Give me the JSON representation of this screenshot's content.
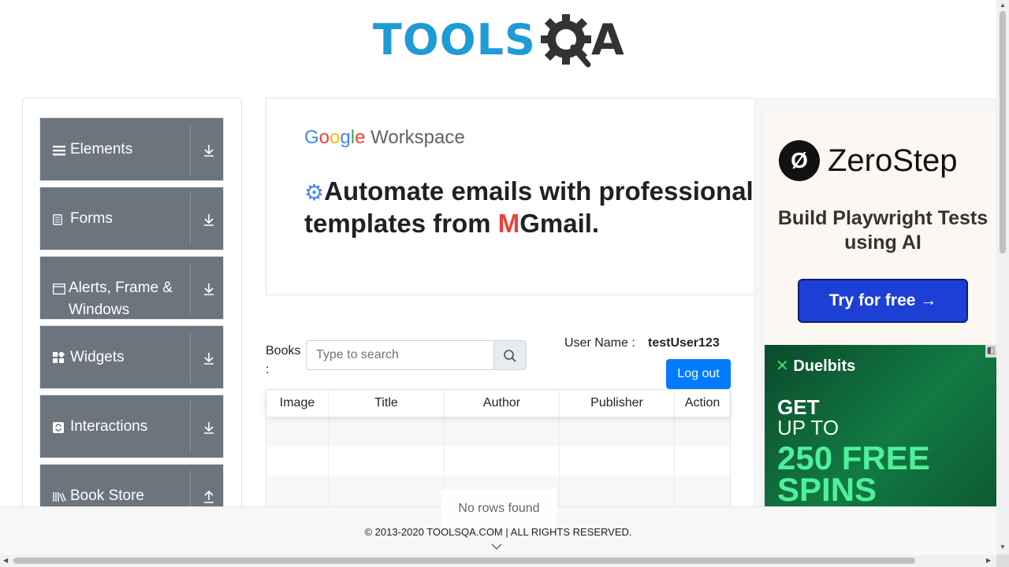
{
  "header": {
    "logo_text": "TOOLS",
    "logo_suffix": "A"
  },
  "sidebar": {
    "groups": [
      {
        "label": "Elements",
        "icon": "hamburger-icon"
      },
      {
        "label": "Forms",
        "icon": "document-icon"
      },
      {
        "label": "Alerts, Frame & Windows",
        "icon": "window-icon"
      },
      {
        "label": "Widgets",
        "icon": "widgets-icon"
      },
      {
        "label": "Interactions",
        "icon": "refresh-icon"
      },
      {
        "label": "Book Store",
        "icon": "books-icon"
      }
    ]
  },
  "ads": {
    "main": {
      "brand_g": [
        "G",
        "o",
        "o",
        "g",
        "l",
        "e"
      ],
      "brand_rest": " Workspace",
      "headline_1": "Automate emails with professional",
      "headline_2a": "templates from ",
      "headline_m": "M",
      "headline_2b": "Gmail."
    },
    "zerostep": {
      "name": "ZeroStep",
      "tagline": "Build Playwright Tests using AI",
      "cta": "Try for free →"
    },
    "duelbits": {
      "brand": "Duelbits",
      "line1": "GET",
      "line2": "UP TO",
      "line3": "250 FREE",
      "line4": "SPINS"
    }
  },
  "books": {
    "label": "Books :",
    "search_placeholder": "Type to search",
    "user_label": "User Name :",
    "user_value": "testUser123",
    "logout_label": "Log out",
    "columns": [
      "Image",
      "Title",
      "Author",
      "Publisher",
      "Action"
    ],
    "empty_text": "No rows found"
  },
  "footer": {
    "text": "© 2013-2020 TOOLSQA.COM | ALL RIGHTS RESERVED."
  },
  "colors": {
    "logo_blue": "#1f9bd6",
    "sidebar_bg": "#6c757d",
    "primary": "#007bff"
  }
}
